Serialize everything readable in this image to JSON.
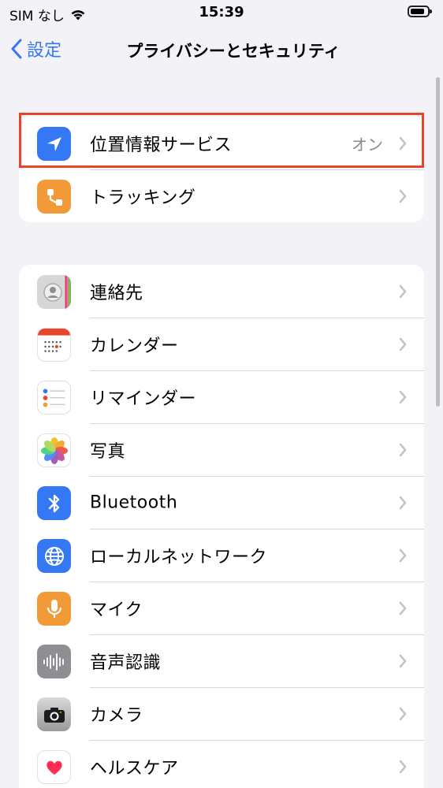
{
  "status_bar": {
    "carrier": "SIM なし",
    "time": "15:39",
    "wifi_icon": "wifi-icon",
    "battery_icon": "battery-icon"
  },
  "nav": {
    "back_label": "設定",
    "title": "プライバシーとセキュリティ"
  },
  "group1": [
    {
      "label": "位置情報サービス",
      "value": "オン",
      "icon": "location-arrow-icon",
      "color": "#3478f6"
    },
    {
      "label": "トラッキング",
      "value": "",
      "icon": "tracking-icon",
      "color": "#f19a37"
    }
  ],
  "group2": [
    {
      "label": "連絡先",
      "icon": "contacts-icon"
    },
    {
      "label": "カレンダー",
      "icon": "calendar-icon"
    },
    {
      "label": "リマインダー",
      "icon": "reminders-icon"
    },
    {
      "label": "写真",
      "icon": "photos-icon"
    },
    {
      "label": "Bluetooth",
      "icon": "bluetooth-icon",
      "color": "#3478f6"
    },
    {
      "label": "ローカルネットワーク",
      "icon": "globe-icon",
      "color": "#3478f6"
    },
    {
      "label": "マイク",
      "icon": "microphone-icon",
      "color": "#f19a37"
    },
    {
      "label": "音声認識",
      "icon": "waveform-icon",
      "color": "#8e8e93"
    },
    {
      "label": "カメラ",
      "icon": "camera-icon",
      "color": "#3a3a3c"
    },
    {
      "label": "ヘルスケア",
      "icon": "health-heart-icon",
      "color": "#ff2d55"
    }
  ],
  "highlight_color": "#e8432b"
}
